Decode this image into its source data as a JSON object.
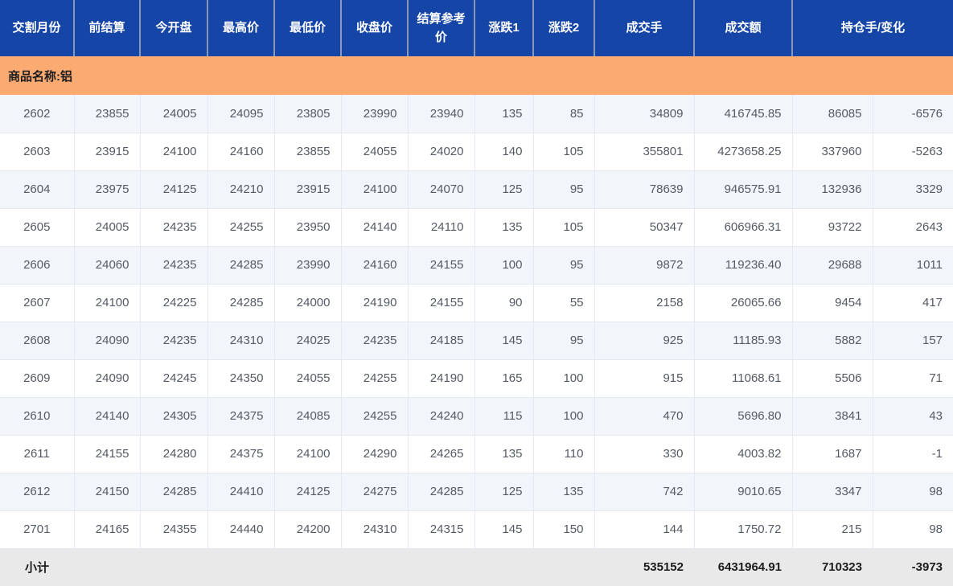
{
  "page": {
    "type": "futures-daily-quotes-table",
    "language": "zh-CN"
  },
  "colors": {
    "header_bg": "#1445A7",
    "header_text": "#FFFFFF",
    "header_divider": "#8997BB",
    "group_row_bg": "#FBAA72",
    "group_row_text": "#1C1C1C",
    "row_alt_bg": "#F2F6FA",
    "row_bg": "#FFFFFF",
    "grid_line": "#E4E9F1",
    "subtotal_bg": "#E9E9E9",
    "data_text": "#545A63"
  },
  "table": {
    "group_label": "商品名称:铝",
    "product_name": "铝",
    "headers": [
      "交割月份",
      "前结算",
      "今开盘",
      "最高价",
      "最低价",
      "收盘价",
      "结算参考价",
      "涨跌1",
      "涨跌2",
      "成交手",
      "成交额",
      "持仓手/变化"
    ],
    "column_keys": [
      "delivery_month",
      "prev_settlement",
      "open",
      "high",
      "low",
      "close",
      "settlement_ref",
      "change1",
      "change2",
      "volume",
      "turnover",
      "open_interest",
      "oi_change"
    ],
    "rows": [
      [
        "2602",
        "23855",
        "24005",
        "24095",
        "23805",
        "23990",
        "23940",
        "135",
        "85",
        "34809",
        "416745.85",
        "86085",
        "-6576"
      ],
      [
        "2603",
        "23915",
        "24100",
        "24160",
        "23855",
        "24055",
        "24020",
        "140",
        "105",
        "355801",
        "4273658.25",
        "337960",
        "-5263"
      ],
      [
        "2604",
        "23975",
        "24125",
        "24210",
        "23915",
        "24100",
        "24070",
        "125",
        "95",
        "78639",
        "946575.91",
        "132936",
        "3329"
      ],
      [
        "2605",
        "24005",
        "24235",
        "24255",
        "23950",
        "24140",
        "24110",
        "135",
        "105",
        "50347",
        "606966.31",
        "93722",
        "2643"
      ],
      [
        "2606",
        "24060",
        "24235",
        "24285",
        "23990",
        "24160",
        "24155",
        "100",
        "95",
        "9872",
        "119236.40",
        "29688",
        "1011"
      ],
      [
        "2607",
        "24100",
        "24225",
        "24285",
        "24000",
        "24190",
        "24155",
        "90",
        "55",
        "2158",
        "26065.66",
        "9454",
        "417"
      ],
      [
        "2608",
        "24090",
        "24235",
        "24310",
        "24025",
        "24235",
        "24185",
        "145",
        "95",
        "925",
        "11185.93",
        "5882",
        "157"
      ],
      [
        "2609",
        "24090",
        "24245",
        "24350",
        "24055",
        "24255",
        "24190",
        "165",
        "100",
        "915",
        "11068.61",
        "5506",
        "71"
      ],
      [
        "2610",
        "24140",
        "24305",
        "24375",
        "24085",
        "24255",
        "24240",
        "115",
        "100",
        "470",
        "5696.80",
        "3841",
        "43"
      ],
      [
        "2611",
        "24155",
        "24280",
        "24375",
        "24100",
        "24290",
        "24265",
        "135",
        "110",
        "330",
        "4003.82",
        "1687",
        "-1"
      ],
      [
        "2612",
        "24150",
        "24285",
        "24410",
        "24125",
        "24275",
        "24285",
        "125",
        "135",
        "742",
        "9010.65",
        "3347",
        "98"
      ],
      [
        "2701",
        "24165",
        "24355",
        "24440",
        "24200",
        "24310",
        "24315",
        "145",
        "150",
        "144",
        "1750.72",
        "215",
        "98"
      ]
    ],
    "subtotal": {
      "label": "小计",
      "volume": "535152",
      "turnover": "6431964.91",
      "open_interest": "710323",
      "oi_change": "-3973"
    }
  }
}
